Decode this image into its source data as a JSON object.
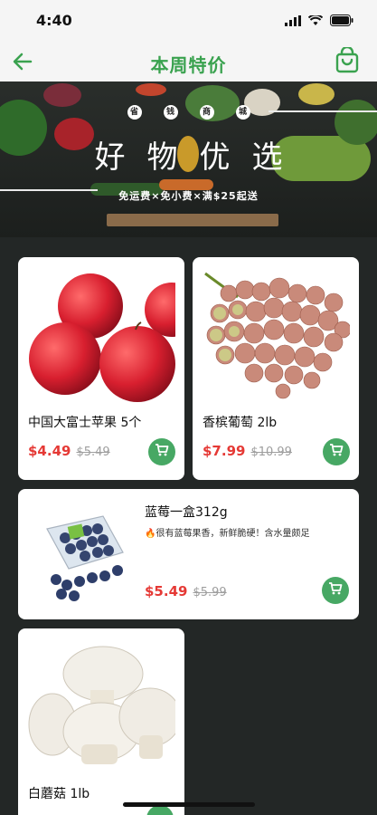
{
  "status_bar": {
    "time": "4:40"
  },
  "nav": {
    "title": "本周特价"
  },
  "banner": {
    "tags": [
      "省",
      "钱",
      "商",
      "城"
    ],
    "headline": "好物优选",
    "subtitle": "免运费×免小费×满$25起送"
  },
  "products": [
    {
      "name": "中国大富士苹果 5个",
      "price": "$4.49",
      "old_price": "$5.49"
    },
    {
      "name": "香槟葡萄 2lb",
      "price": "$7.99",
      "old_price": "$10.99"
    },
    {
      "name": "蓝莓一盒312g",
      "desc": "🔥很有蓝莓果香，新鲜脆硬！含水量颇足",
      "price": "$5.49",
      "old_price": "$5.99"
    },
    {
      "name": "白蘑菇 1lb"
    }
  ],
  "colors": {
    "accent": "#3aa24f",
    "price": "#e53935",
    "cart_button": "#47a864"
  }
}
